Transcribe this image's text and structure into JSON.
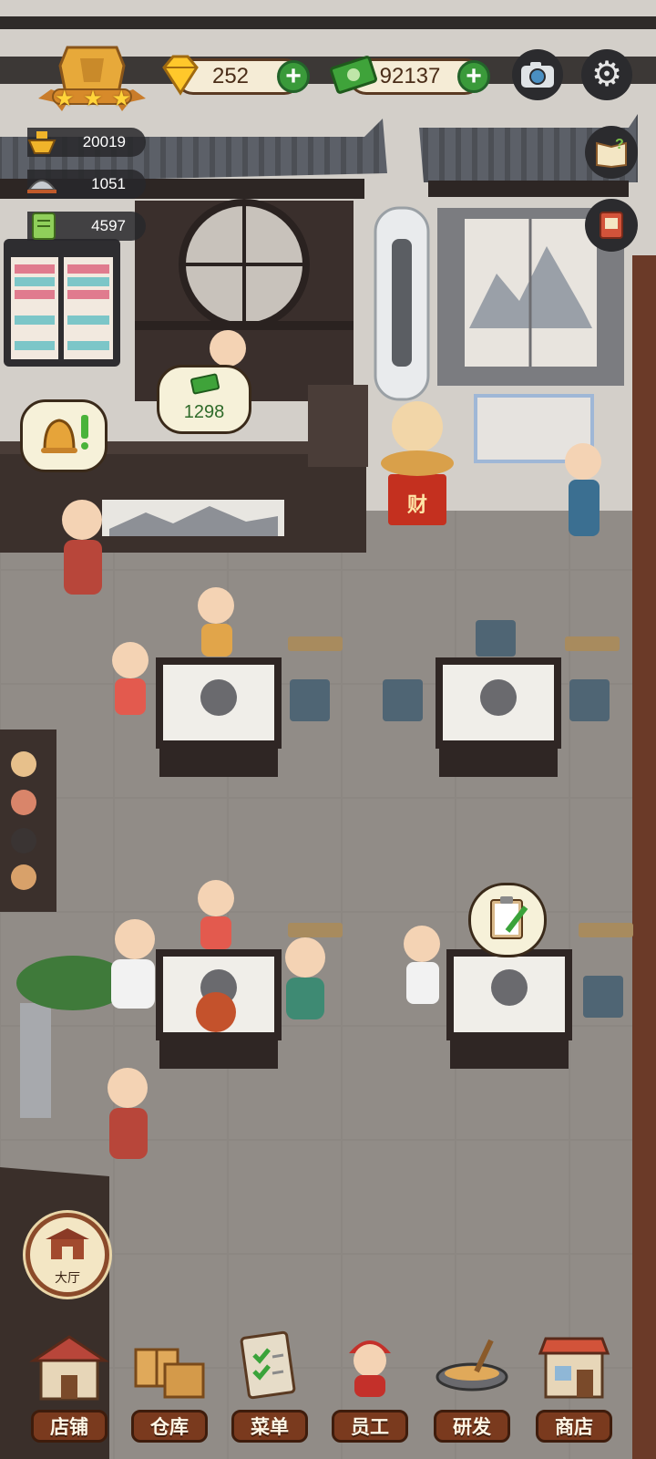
{
  "hud": {
    "gems": "252",
    "cash": "92137",
    "star_count": 3,
    "gem_icon": "gem-icon",
    "cash_icon": "cash-icon",
    "camera_icon": "camera-icon",
    "settings_icon": "gear-icon"
  },
  "stats": {
    "bowl": "20019",
    "service": "1051",
    "ticket": "4597"
  },
  "bubbles": {
    "bell_icon": "bell-icon",
    "cash_earned": "1298",
    "order_icon": "clipboard-icon"
  },
  "side_buttons": {
    "guide_icon": "book-question-icon",
    "menu_book_icon": "red-book-icon"
  },
  "lucky_cat": {
    "sign": "财"
  },
  "hall_button": {
    "label": "大厅"
  },
  "nav": {
    "items": [
      {
        "label": "店铺",
        "icon": "shop-icon"
      },
      {
        "label": "仓库",
        "icon": "warehouse-icon"
      },
      {
        "label": "菜单",
        "icon": "menu-clipboard-icon"
      },
      {
        "label": "员工",
        "icon": "staff-icon"
      },
      {
        "label": "研发",
        "icon": "wok-icon"
      },
      {
        "label": "商店",
        "icon": "store-icon"
      }
    ]
  },
  "colors": {
    "floor": "#8a8581",
    "wall": "#d6d2cc",
    "wood": "#3c2e28",
    "accent_green": "#3a9a3a",
    "nav_tab": "#7a3a1e"
  }
}
